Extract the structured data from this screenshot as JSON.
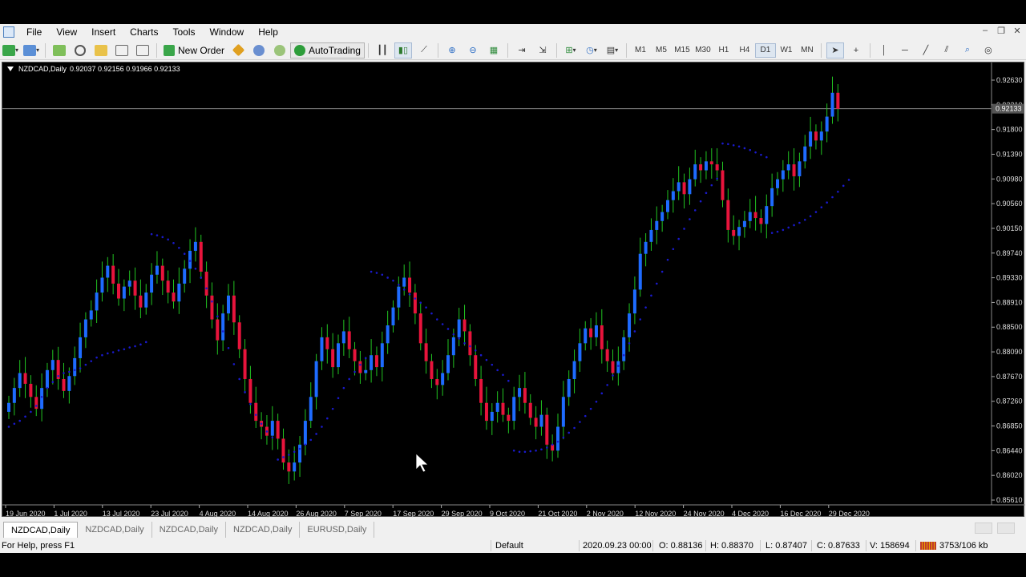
{
  "menu": {
    "items": [
      "File",
      "View",
      "Insert",
      "Charts",
      "Tools",
      "Window",
      "Help"
    ]
  },
  "toolbar": {
    "new_order_label": "New Order",
    "autotrading_label": "AutoTrading",
    "timeframes": [
      "M1",
      "M5",
      "M15",
      "M30",
      "H1",
      "H4",
      "D1",
      "W1",
      "MN"
    ],
    "active_timeframe": "D1"
  },
  "chart": {
    "symbol_label": "NZDCAD,Daily",
    "ohlc_text": "0.92037 0.92156 0.91966 0.92133",
    "current_price_label": "0.92133",
    "colors": {
      "background": "#000000",
      "bull": "#1e6bff",
      "bear": "#e8143c",
      "wick_bull": "#21c421",
      "wick_bear": "#21c421",
      "sar": "#1a1acc",
      "price_line": "#8a8a8a"
    }
  },
  "chart_data": {
    "type": "candlestick",
    "y_ticks": [
      "0.92630",
      "0.92210",
      "0.91800",
      "0.91390",
      "0.90980",
      "0.90560",
      "0.90150",
      "0.89740",
      "0.89330",
      "0.88910",
      "0.88500",
      "0.88090",
      "0.87670",
      "0.87260",
      "0.86850",
      "0.86440",
      "0.86020",
      "0.85610"
    ],
    "x_ticks": [
      "19 Jun 2020",
      "1 Jul 2020",
      "13 Jul 2020",
      "23 Jul 2020",
      "4 Aug 2020",
      "14 Aug 2020",
      "26 Aug 2020",
      "7 Sep 2020",
      "17 Sep 2020",
      "29 Sep 2020",
      "9 Oct 2020",
      "21 Oct 2020",
      "2 Nov 2020",
      "12 Nov 2020",
      "24 Nov 2020",
      "4 Dec 2020",
      "16 Dec 2020",
      "29 Dec 2020"
    ],
    "ylim": [
      0.8549,
      0.928
    ],
    "current_price": 0.92133,
    "closes": [
      0.872,
      0.8745,
      0.877,
      0.8752,
      0.873,
      0.871,
      0.8745,
      0.8775,
      0.8792,
      0.876,
      0.874,
      0.8765,
      0.8795,
      0.883,
      0.886,
      0.8875,
      0.8905,
      0.893,
      0.895,
      0.892,
      0.8895,
      0.8915,
      0.8925,
      0.89,
      0.888,
      0.8905,
      0.8935,
      0.895,
      0.8925,
      0.8905,
      0.889,
      0.892,
      0.8945,
      0.8975,
      0.899,
      0.894,
      0.89,
      0.886,
      0.8825,
      0.887,
      0.89,
      0.8855,
      0.881,
      0.876,
      0.872,
      0.869,
      0.868,
      0.8665,
      0.869,
      0.866,
      0.862,
      0.8605,
      0.862,
      0.865,
      0.869,
      0.873,
      0.879,
      0.883,
      0.881,
      0.878,
      0.882,
      0.884,
      0.881,
      0.879,
      0.877,
      0.8775,
      0.88,
      0.878,
      0.882,
      0.885,
      0.888,
      0.8915,
      0.893,
      0.8905,
      0.887,
      0.882,
      0.879,
      0.876,
      0.875,
      0.877,
      0.88,
      0.883,
      0.886,
      0.884,
      0.88,
      0.876,
      0.872,
      0.869,
      0.8705,
      0.872,
      0.87,
      0.869,
      0.873,
      0.8745,
      0.872,
      0.8695,
      0.868,
      0.87,
      0.865,
      0.864,
      0.868,
      0.873,
      0.876,
      0.879,
      0.882,
      0.8845,
      0.883,
      0.885,
      0.881,
      0.879,
      0.877,
      0.879,
      0.883,
      0.887,
      0.891,
      0.897,
      0.899,
      0.901,
      0.9025,
      0.904,
      0.906,
      0.9075,
      0.909,
      0.907,
      0.9095,
      0.912,
      0.911,
      0.9125,
      0.912,
      0.911,
      0.906,
      0.901,
      0.9,
      0.9015,
      0.9025,
      0.904,
      0.903,
      0.902,
      0.905,
      0.908,
      0.9095,
      0.911,
      0.912,
      0.91,
      0.9125,
      0.915,
      0.9175,
      0.916,
      0.9175,
      0.92,
      0.924,
      0.9213
    ],
    "sar": [
      0.868,
      0.8685,
      0.869,
      0.8697,
      0.8705,
      0.8715,
      0.873,
      0.8745,
      0.8755,
      0.8765,
      0.877,
      0.8772,
      0.8775,
      0.8778,
      0.8784,
      0.879,
      0.8796,
      0.88,
      0.8803,
      0.8805,
      0.8808,
      0.881,
      0.8813,
      0.8815,
      0.8818,
      0.8822,
      0.9003,
      0.9001,
      0.8998,
      0.8994,
      0.8988,
      0.898,
      0.897,
      0.8958,
      0.8945,
      0.893,
      0.8912,
      0.889,
      0.8865,
      0.884,
      0.8812,
      0.8785,
      0.876,
      0.8738,
      0.8718,
      0.87,
      0.8685,
      0.8672,
      0.8662,
      0.8625,
      0.8629,
      0.8633,
      0.8638,
      0.8643,
      0.865,
      0.8658,
      0.8668,
      0.868,
      0.8694,
      0.871,
      0.8728,
      0.8745,
      0.876,
      0.8772,
      0.8784,
      0.8795,
      0.894,
      0.8938,
      0.8935,
      0.893,
      0.8925,
      0.8918,
      0.891,
      0.8902,
      0.8895,
      0.8888,
      0.888,
      0.887,
      0.886,
      0.8852,
      0.8844,
      0.8835,
      0.8828,
      0.882,
      0.8815,
      0.8808,
      0.88,
      0.8792,
      0.8784,
      0.8775,
      0.8767,
      0.8757,
      0.864,
      0.8638,
      0.8638,
      0.8639,
      0.864,
      0.8642,
      0.8645,
      0.865,
      0.8655,
      0.8662,
      0.867,
      0.8678,
      0.8688,
      0.8698,
      0.871,
      0.8722,
      0.8736,
      0.875,
      0.8766,
      0.8782,
      0.88,
      0.882,
      0.884,
      0.886,
      0.888,
      0.89,
      0.892,
      0.894,
      0.896,
      0.8978,
      0.8995,
      0.9012,
      0.9028,
      0.9043,
      0.9058,
      0.9072,
      0.9085,
      0.9096,
      0.9155,
      0.9154,
      0.9152,
      0.915,
      0.9147,
      0.9144,
      0.914,
      0.9136,
      0.9132,
      0.9005,
      0.9007,
      0.901,
      0.9014,
      0.9018,
      0.9022,
      0.9027,
      0.9033,
      0.904,
      0.9048,
      0.9056,
      0.9065,
      0.9074,
      0.9084,
      0.9094
    ]
  },
  "tabs": {
    "items": [
      "NZDCAD,Daily",
      "NZDCAD,Daily",
      "NZDCAD,Daily",
      "NZDCAD,Daily",
      "EURUSD,Daily"
    ],
    "active_index": 0
  },
  "status": {
    "help": "For Help, press F1",
    "profile": "Default",
    "datetime": "2020.09.23 00:00",
    "open": "O: 0.88136",
    "high": "H: 0.88370",
    "low": "L: 0.87407",
    "close": "C: 0.87633",
    "volume": "V: 158694",
    "traffic": "3753/106 kb"
  }
}
